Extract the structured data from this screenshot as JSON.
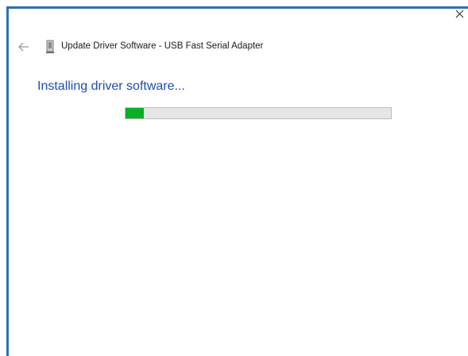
{
  "window": {
    "title": "Update Driver Software - USB Fast Serial Adapter",
    "heading": "Installing driver software...",
    "progress": 0.07,
    "accent_color": "#2b6fb6",
    "heading_color": "#1e4fa8",
    "progress_color": "#06b025"
  },
  "icons": {
    "close": "close-icon",
    "back": "back-arrow-icon",
    "device": "usb-device-icon"
  }
}
